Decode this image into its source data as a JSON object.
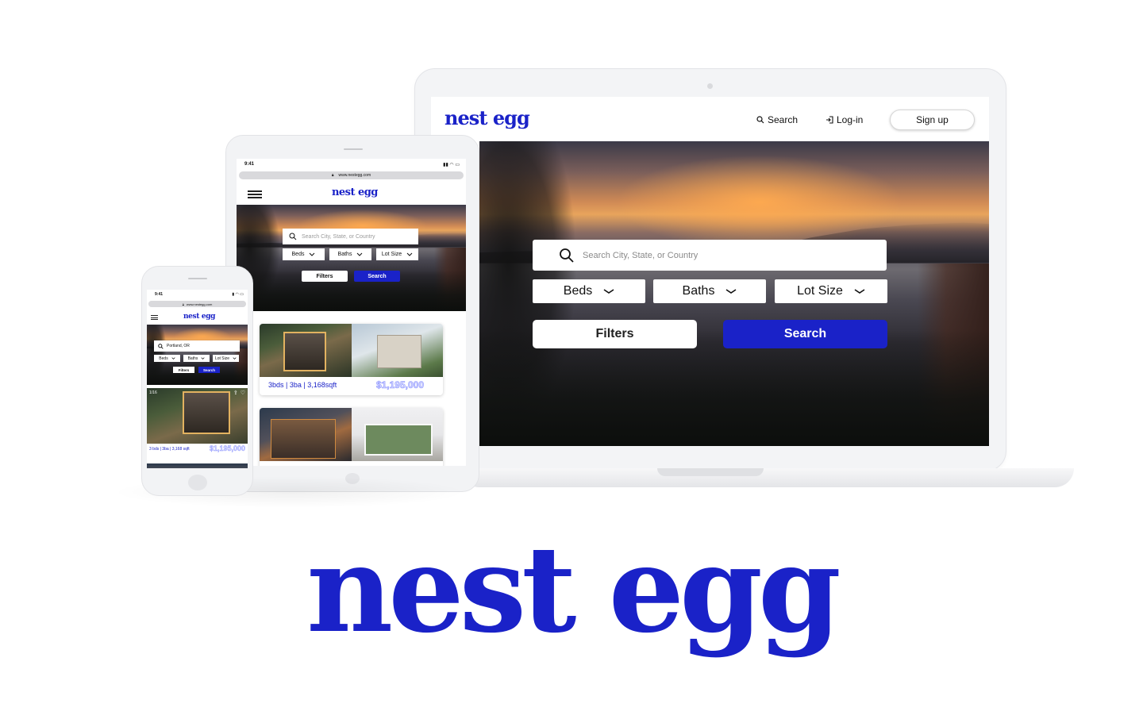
{
  "brand": {
    "name": "nest egg",
    "color": "#1a22c8"
  },
  "laptop": {
    "nav": {
      "logo": "nest egg",
      "search_label": "Search",
      "login_label": "Log-in",
      "signup_label": "Sign up"
    },
    "hero": {
      "search_placeholder": "Search City, State, or Country",
      "dropdowns": [
        "Beds",
        "Baths",
        "Lot Size"
      ],
      "filters_label": "Filters",
      "search_button": "Search"
    }
  },
  "tablet": {
    "status_time": "9:41",
    "url": "www.nestegg.com",
    "logo": "nest egg",
    "hero": {
      "search_placeholder": "Search City, State, or Country",
      "dropdowns": [
        "Beds",
        "Baths",
        "Lot Size"
      ],
      "filters_label": "Filters",
      "search_button": "Search"
    },
    "listings": [
      {
        "details": "3bds | 3ba | 3,168sqft",
        "price": "$1,195,000"
      }
    ]
  },
  "phone": {
    "status_time": "9:41",
    "url": "www.nestegg.com",
    "logo": "nest egg",
    "hero": {
      "search_value": "Portland, OR",
      "dropdowns": [
        "Beds",
        "Baths",
        "Lot Size"
      ],
      "filters_label": "Filters",
      "search_button": "Search"
    },
    "listing": {
      "counter": "1/16",
      "details": "3 bds | 3ba | 3,168 sqft",
      "price": "$1,195,000"
    }
  },
  "footer_logo": "nest egg"
}
